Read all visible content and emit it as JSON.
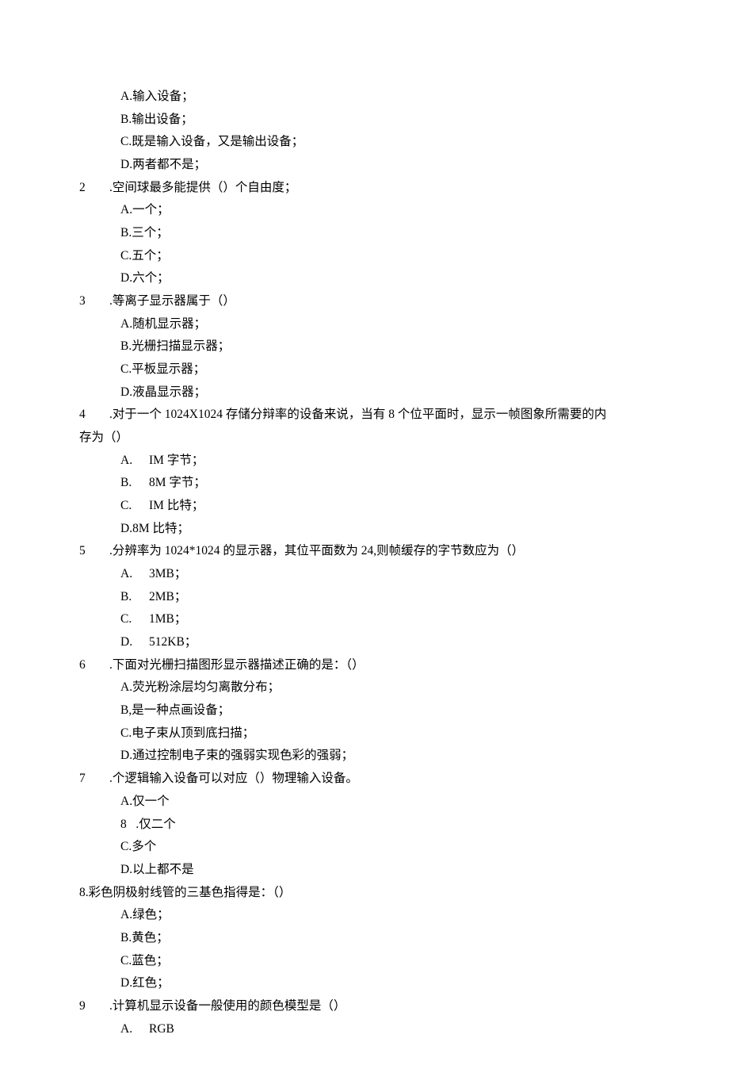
{
  "orphan_options": [
    "A.输入设备；",
    "B.输出设备；",
    "C.既是输入设备，又是输出设备；",
    "D.两者都不是；"
  ],
  "questions": [
    {
      "number": "2",
      "text": ".空间球最多能提供（）个自由度；",
      "options": [
        "A.一个；",
        "B.三个；",
        "C.五个；",
        "D.六个；"
      ]
    },
    {
      "number": "3",
      "text": ".等离子显示器属于（）",
      "options": [
        "A.随机显示器；",
        "B.光栅扫描显示器；",
        "C.平板显示器；",
        "D.液晶显示器；"
      ]
    },
    {
      "number": "4",
      "text": ".对于一个 1024X1024 存储分辩率的设备来说，当有 8 个位平面时，显示一帧图象所需要的内",
      "text_cont": "存为（）",
      "options_spaced": [
        {
          "label": "A.",
          "value": "IM 字节；"
        },
        {
          "label": "B.",
          "value": "8M 字节；"
        },
        {
          "label": "C.",
          "value": "IM 比特；"
        }
      ],
      "options_tail": "D.8M 比特；"
    },
    {
      "number": "5",
      "text": ".分辨率为 1024*1024 的显示器，其位平面数为 24,则帧缓存的字节数应为（）",
      "options_spaced": [
        {
          "label": "A.",
          "value": "3MB；"
        },
        {
          "label": "B.",
          "value": "2MB；"
        },
        {
          "label": "C.",
          "value": "1MB；"
        },
        {
          "label": "D.",
          "value": "512KB；"
        }
      ]
    },
    {
      "number": "6",
      "text": ".下面对光栅扫描图形显示器描述正确的是：（）",
      "options": [
        "A.荧光粉涂层均匀离散分布；",
        "B,是一种点画设备；",
        "C.电子束从顶到底扫描；",
        "D.通过控制电子束的强弱实现色彩的强弱；"
      ]
    },
    {
      "number": "7",
      "text": ".个逻辑输入设备可以对应（）物理输入设备。",
      "options": [
        "A.仅一个",
        "8   .仅二个",
        "C.多个",
        "D.以上都不是"
      ]
    },
    {
      "number": "8",
      "flush": true,
      "text": ".彩色阴极射线管的三基色指得是：（）",
      "options": [
        "A.绿色；",
        "B.黄色；",
        "C.蓝色；",
        "D.红色；"
      ]
    },
    {
      "number": "9",
      "text": ".计算机显示设备一般使用的颜色模型是（）",
      "options_spaced": [
        {
          "label": "A.",
          "value": "RGB"
        }
      ]
    }
  ]
}
